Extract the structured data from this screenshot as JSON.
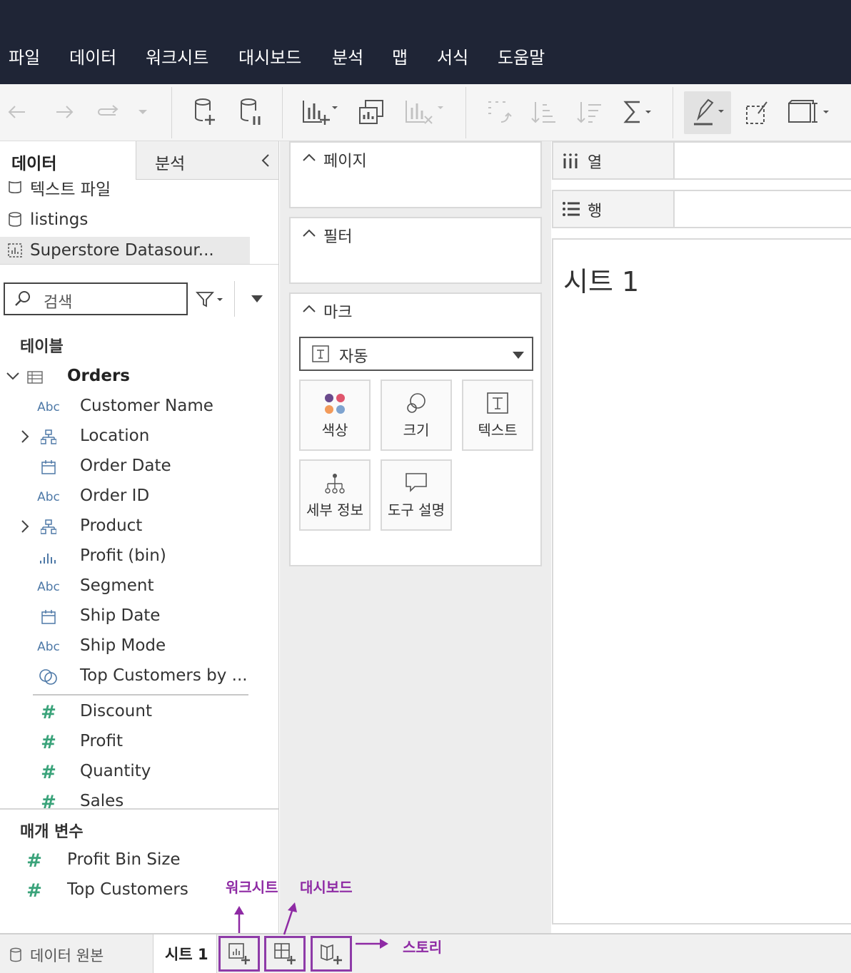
{
  "menu": [
    "파일",
    "데이터",
    "워크시트",
    "대시보드",
    "분석",
    "맵",
    "서식",
    "도움말"
  ],
  "left_panel": {
    "tab_data": "데이터",
    "tab_analysis": "분석",
    "datasources": [
      "텍스트 파일",
      "listings",
      "Superstore Datasour..."
    ],
    "search_placeholder": "검색",
    "tables_title": "테이블",
    "table_name": "Orders",
    "dimensions": [
      {
        "label": "Customer Name",
        "icon": "abc"
      },
      {
        "label": "Location",
        "icon": "hierarchy"
      },
      {
        "label": "Order Date",
        "icon": "calendar"
      },
      {
        "label": "Order ID",
        "icon": "abc"
      },
      {
        "label": "Product",
        "icon": "hierarchy"
      },
      {
        "label": "Profit (bin)",
        "icon": "bins"
      },
      {
        "label": "Segment",
        "icon": "abc"
      },
      {
        "label": "Ship Date",
        "icon": "calendar"
      },
      {
        "label": "Ship Mode",
        "icon": "abc"
      },
      {
        "label": "Top Customers by ...",
        "icon": "set"
      }
    ],
    "measures": [
      "Discount",
      "Profit",
      "Quantity",
      "Sales"
    ],
    "abc_text": "Abc",
    "params_title": "매개 변수",
    "parameters": [
      "Profit Bin Size",
      "Top Customers"
    ]
  },
  "cards": {
    "pages": "페이지",
    "filters": "필터",
    "marks": "마크",
    "mark_type": "자동",
    "mark_buttons": [
      "색상",
      "크기",
      "텍스트",
      "세부 정보",
      "도구 설명"
    ]
  },
  "shelves": {
    "columns": "열",
    "rows": "행"
  },
  "canvas": {
    "sheet_title": "시트 1"
  },
  "bottom": {
    "data_source": "데이터 원본",
    "sheet_tab": "시트 1"
  },
  "annotations": {
    "worksheet": "워크시트",
    "dashboard": "대시보드",
    "story": "스토리"
  },
  "colors": {
    "menubar": "#1f2536",
    "annotation": "#8e2aa4",
    "measure": "#3aa37a",
    "dimension": "#4e79a7"
  }
}
